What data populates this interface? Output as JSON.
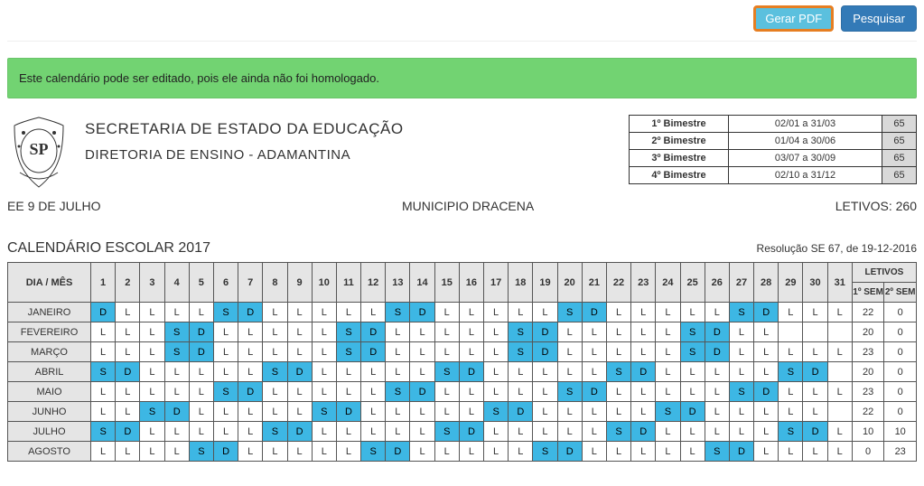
{
  "topbar": {
    "gerar_pdf": "Gerar PDF",
    "pesquisar": "Pesquisar"
  },
  "alert": "Este calendário pode ser editado, pois ele ainda não foi homologado.",
  "org": {
    "line1": "SECRETARIA DE ESTADO DA EDUCAÇÃO",
    "line2": "DIRETORIA DE ENSINO - ADAMANTINA"
  },
  "bimestres": [
    {
      "label": "1º Bimestre",
      "range": "02/01 a 31/03",
      "days": "65"
    },
    {
      "label": "2º Bimestre",
      "range": "01/04 a 30/06",
      "days": "65"
    },
    {
      "label": "3º Bimestre",
      "range": "03/07 a 30/09",
      "days": "65"
    },
    {
      "label": "4º Bimestre",
      "range": "02/10 a 31/12",
      "days": "65"
    }
  ],
  "info": {
    "school": "EE 9 DE JULHO",
    "municipio": "MUNICIPIO DRACENA",
    "letivos": "LETIVOS: 260"
  },
  "cal_header": {
    "title": "CALENDÁRIO ESCOLAR 2017",
    "resolution": "Resolução SE 67, de 19-12-2016"
  },
  "calendar": {
    "dia_mes": "DIA / MÊS",
    "days": [
      "1",
      "2",
      "3",
      "4",
      "5",
      "6",
      "7",
      "8",
      "9",
      "10",
      "11",
      "12",
      "13",
      "14",
      "15",
      "16",
      "17",
      "18",
      "19",
      "20",
      "21",
      "22",
      "23",
      "24",
      "25",
      "26",
      "27",
      "28",
      "29",
      "30",
      "31"
    ],
    "letivos_header": "LETIVOS",
    "sem1": "1º SEM",
    "sem2": "2º SEM",
    "months": [
      {
        "name": "JANEIRO",
        "cells": [
          "D",
          "L",
          "L",
          "L",
          "L",
          "S",
          "D",
          "L",
          "L",
          "L",
          "L",
          "L",
          "S",
          "D",
          "L",
          "L",
          "L",
          "L",
          "L",
          "S",
          "D",
          "L",
          "L",
          "L",
          "L",
          "L",
          "S",
          "D",
          "L",
          "L",
          "L"
        ],
        "s1": "22",
        "s2": "0"
      },
      {
        "name": "FEVEREIRO",
        "cells": [
          "L",
          "L",
          "L",
          "S",
          "D",
          "L",
          "L",
          "L",
          "L",
          "L",
          "S",
          "D",
          "L",
          "L",
          "L",
          "L",
          "L",
          "S",
          "D",
          "L",
          "L",
          "L",
          "L",
          "L",
          "S",
          "D",
          "L",
          "L",
          "",
          "",
          ""
        ],
        "s1": "20",
        "s2": "0"
      },
      {
        "name": "MARÇO",
        "cells": [
          "L",
          "L",
          "L",
          "S",
          "D",
          "L",
          "L",
          "L",
          "L",
          "L",
          "S",
          "D",
          "L",
          "L",
          "L",
          "L",
          "L",
          "S",
          "D",
          "L",
          "L",
          "L",
          "L",
          "L",
          "S",
          "D",
          "L",
          "L",
          "L",
          "L",
          "L"
        ],
        "s1": "23",
        "s2": "0"
      },
      {
        "name": "ABRIL",
        "cells": [
          "S",
          "D",
          "L",
          "L",
          "L",
          "L",
          "L",
          "S",
          "D",
          "L",
          "L",
          "L",
          "L",
          "L",
          "S",
          "D",
          "L",
          "L",
          "L",
          "L",
          "L",
          "S",
          "D",
          "L",
          "L",
          "L",
          "L",
          "L",
          "S",
          "D",
          ""
        ],
        "s1": "20",
        "s2": "0"
      },
      {
        "name": "MAIO",
        "cells": [
          "L",
          "L",
          "L",
          "L",
          "L",
          "S",
          "D",
          "L",
          "L",
          "L",
          "L",
          "L",
          "S",
          "D",
          "L",
          "L",
          "L",
          "L",
          "L",
          "S",
          "D",
          "L",
          "L",
          "L",
          "L",
          "L",
          "S",
          "D",
          "L",
          "L",
          "L"
        ],
        "s1": "23",
        "s2": "0"
      },
      {
        "name": "JUNHO",
        "cells": [
          "L",
          "L",
          "S",
          "D",
          "L",
          "L",
          "L",
          "L",
          "L",
          "S",
          "D",
          "L",
          "L",
          "L",
          "L",
          "L",
          "S",
          "D",
          "L",
          "L",
          "L",
          "L",
          "L",
          "S",
          "D",
          "L",
          "L",
          "L",
          "L",
          "L",
          ""
        ],
        "s1": "22",
        "s2": "0"
      },
      {
        "name": "JULHO",
        "cells": [
          "S",
          "D",
          "L",
          "L",
          "L",
          "L",
          "L",
          "S",
          "D",
          "L",
          "L",
          "L",
          "L",
          "L",
          "S",
          "D",
          "L",
          "L",
          "L",
          "L",
          "L",
          "S",
          "D",
          "L",
          "L",
          "L",
          "L",
          "L",
          "S",
          "D",
          "L"
        ],
        "s1": "10",
        "s2": "10"
      },
      {
        "name": "AGOSTO",
        "cells": [
          "L",
          "L",
          "L",
          "L",
          "S",
          "D",
          "L",
          "L",
          "L",
          "L",
          "L",
          "S",
          "D",
          "L",
          "L",
          "L",
          "L",
          "L",
          "S",
          "D",
          "L",
          "L",
          "L",
          "L",
          "L",
          "S",
          "D",
          "L",
          "L",
          "L",
          "L"
        ],
        "s1": "0",
        "s2": "23"
      }
    ]
  }
}
